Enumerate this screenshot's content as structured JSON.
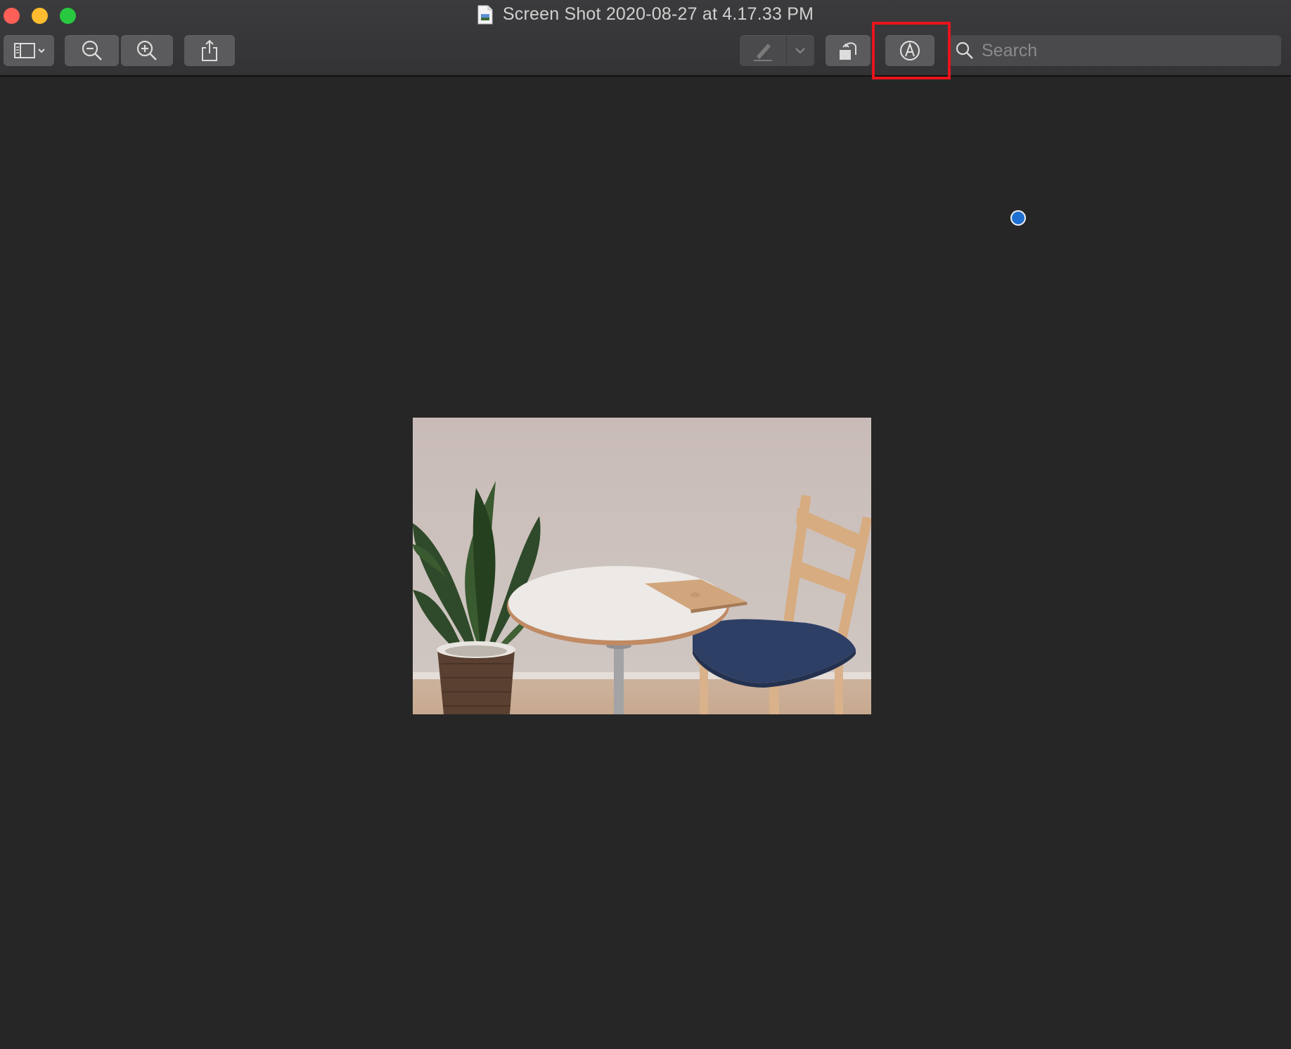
{
  "window": {
    "title": "Screen Shot 2020-08-27 at 4.17.33 PM"
  },
  "toolbar": {
    "sidebar_icon": "sidebar-icon",
    "zoom_out_icon": "zoom-out-icon",
    "zoom_in_icon": "zoom-in-icon",
    "share_icon": "share-icon",
    "pen_icon": "pen-icon",
    "rotate_icon": "rotate-icon",
    "markup_icon": "markup-icon"
  },
  "search": {
    "placeholder": "Search",
    "value": ""
  },
  "colors": {
    "close": "#fe5f57",
    "minimize": "#febc2e",
    "maximize": "#28c840",
    "highlight": "#e8141c",
    "cursor": "#1f6fd1"
  }
}
